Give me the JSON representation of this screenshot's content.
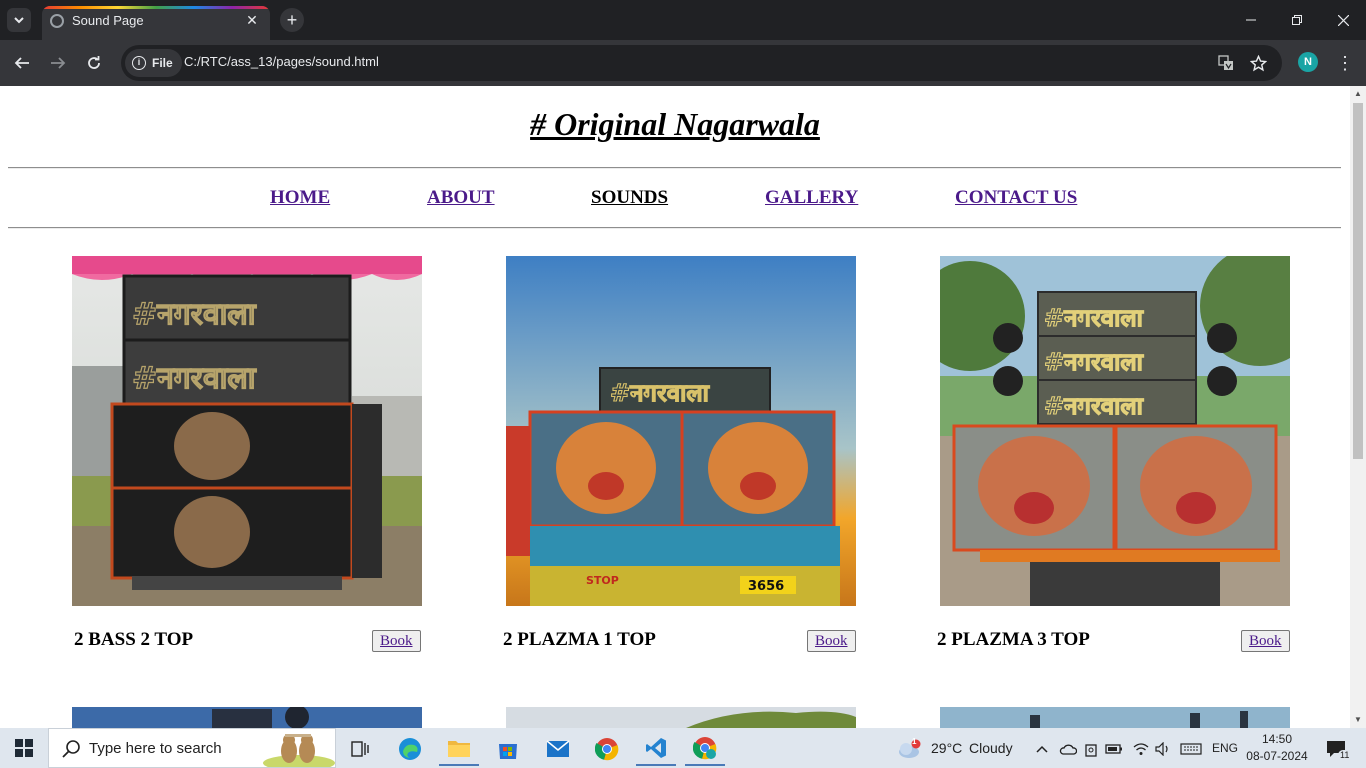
{
  "browser": {
    "tab_title": "Sound Page",
    "address_scheme": "File",
    "url": "C:/RTC/ass_13/pages/sound.html",
    "profile_initial": "N"
  },
  "page": {
    "site_title": "# Original Nagarwala",
    "nav": [
      {
        "label": "HOME",
        "current": false
      },
      {
        "label": "ABOUT",
        "current": false
      },
      {
        "label": "SOUNDS",
        "current": true
      },
      {
        "label": "GALLERY",
        "current": false
      },
      {
        "label": "CONTACT US",
        "current": false
      }
    ],
    "products": [
      {
        "name": "2 BASS 2 TOP",
        "button": "Book",
        "image_text": [
          "#नगरवाला",
          "#नगरवाला"
        ]
      },
      {
        "name": "2 PLAZMA 1 TOP",
        "button": "Book",
        "image_text": [
          "#नगरवाला"
        ],
        "plate": "3656",
        "plate_text": "STOP"
      },
      {
        "name": "2 PLAZMA 3 TOP",
        "button": "Book",
        "image_text": [
          "#नगरवाला",
          "#नगरवाला",
          "#नगरवाला"
        ]
      }
    ]
  },
  "taskbar": {
    "search_placeholder": "Type here to search",
    "weather_temp": "29°C",
    "weather_desc": "Cloudy",
    "weather_badge": "1",
    "language": "ENG",
    "time": "14:50",
    "date": "08-07-2024",
    "notification_count": "11"
  },
  "colors": {
    "chrome_dark": "#202124",
    "chrome_toolbar": "#35363a",
    "link_visited": "#4b1a8a",
    "taskbar": "#dfe6ee"
  }
}
